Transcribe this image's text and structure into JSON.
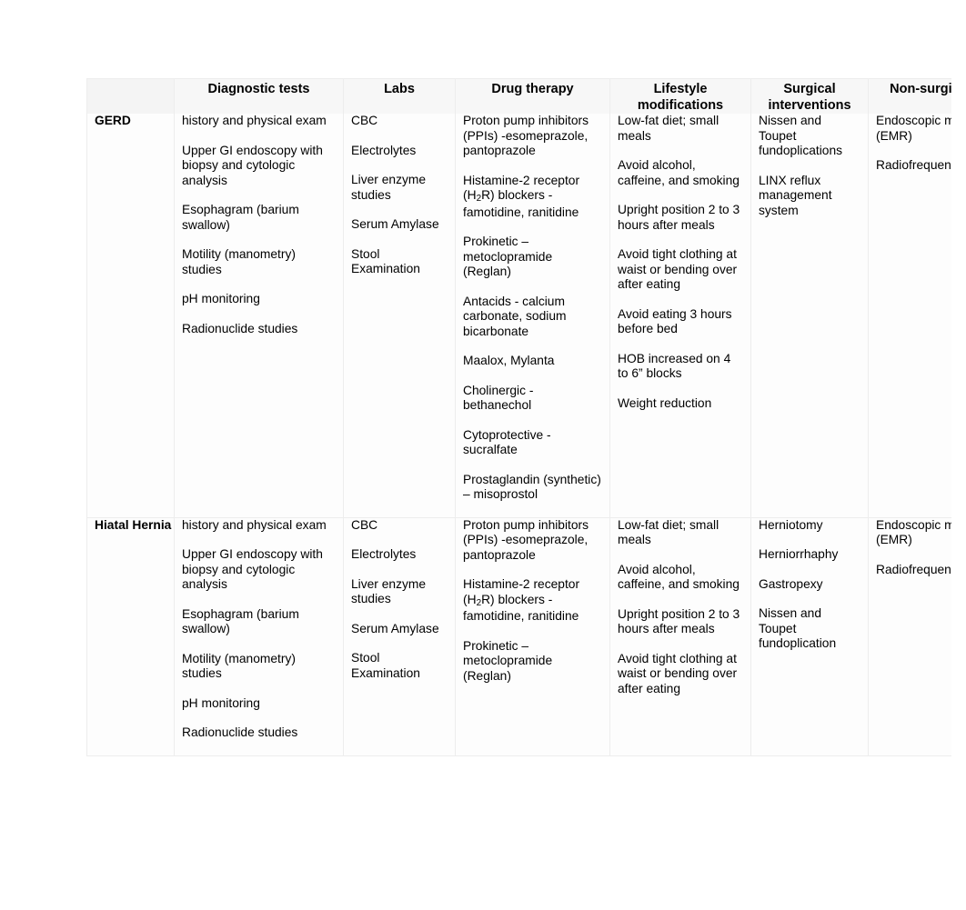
{
  "table": {
    "headers": [
      {
        "id": "condition",
        "label": ""
      },
      {
        "id": "diagnostic_tests",
        "label": "Diagnostic tests"
      },
      {
        "id": "labs",
        "label": "Labs"
      },
      {
        "id": "drug_therapy",
        "label": "Drug therapy"
      },
      {
        "id": "lifestyle_modifications",
        "label": "Lifestyle modifications"
      },
      {
        "id": "surgical_interventions",
        "label": "Surgical interventions"
      },
      {
        "id": "non_surgical_interventions",
        "label": "Non-surgical interventions"
      }
    ],
    "rows": [
      {
        "condition": "GERD",
        "diagnostic_tests": [
          "history and physical exam",
          "Upper GI endoscopy with biopsy and cytologic analysis",
          "Esophagram (barium swallow)",
          "Motility (manometry) studies",
          "pH monitoring",
          "Radionuclide studies"
        ],
        "labs": [
          "CBC",
          "Electrolytes",
          "Liver enzyme studies",
          "Serum Amylase",
          "Stool Examination"
        ],
        "drug_therapy": [
          "Proton pump inhibitors (PPIs) -esomeprazole, pantoprazole",
          "Histamine-2 receptor (H2R) blockers - famotidine, ranitidine",
          "Prokinetic – metoclopramide (Reglan)",
          "Antacids - calcium carbonate, sodium bicarbonate",
          "Maalox, Mylanta",
          "Cholinergic - bethanechol",
          "Cytoprotective - sucralfate",
          "Prostaglandin (synthetic) – misoprostol"
        ],
        "lifestyle_modifications": [
          "Low-fat diet; small meals",
          "Avoid alcohol, caffeine, and smoking",
          "Upright position 2 to 3 hours after meals",
          "Avoid tight clothing at waist or bending over after eating",
          "Avoid eating 3 hours before bed",
          "HOB increased on 4 to 6” blocks",
          "Weight reduction"
        ],
        "surgical_interventions": [
          "Nissen and Toupet fundoplications",
          "LINX reflux management system"
        ],
        "non_surgical_interventions": [
          "Endoscopic mucosal resection (EMR)",
          "Radiofrequency ablation"
        ]
      },
      {
        "condition": "Hiatal Hernia",
        "diagnostic_tests": [
          "history and physical exam",
          "Upper GI endoscopy with biopsy and cytologic analysis",
          "Esophagram (barium swallow)",
          "Motility (manometry) studies",
          "pH monitoring",
          "Radionuclide studies"
        ],
        "labs": [
          "CBC",
          "Electrolytes",
          "Liver enzyme studies",
          "Serum Amylase",
          "Stool Examination"
        ],
        "drug_therapy": [
          "Proton pump inhibitors (PPIs) -esomeprazole, pantoprazole",
          "Histamine-2 receptor (H2R) blockers - famotidine, ranitidine",
          "Prokinetic – metoclopramide (Reglan)"
        ],
        "lifestyle_modifications": [
          "Low-fat diet; small meals",
          "Avoid alcohol, caffeine, and smoking",
          "Upright position 2 to 3 hours after meals",
          "Avoid tight clothing at waist or bending over after eating"
        ],
        "surgical_interventions": [
          "Herniotomy",
          "Herniorrhaphy",
          "Gastropexy",
          "Nissen and Toupet fundoplication"
        ],
        "non_surgical_interventions": [
          "Endoscopic mucosal resection (EMR)",
          "Radiofrequency ablation"
        ]
      }
    ]
  },
  "style": {
    "border_color": "#ededed",
    "header_background": "#f7f7f7",
    "cell_background": "#fdfdfd",
    "text_color": "#000000"
  }
}
